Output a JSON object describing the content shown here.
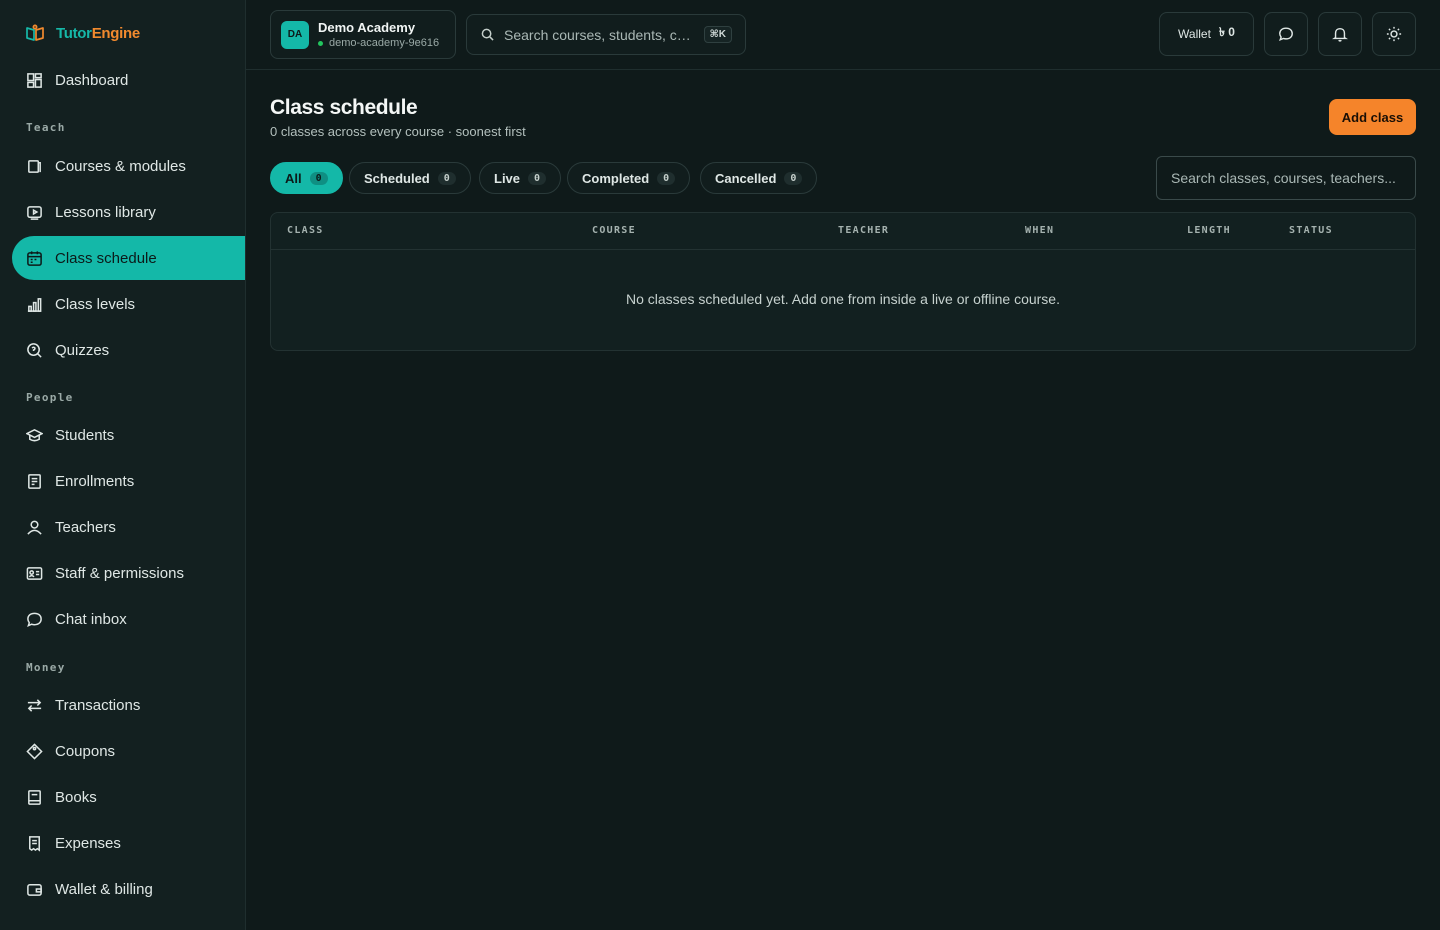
{
  "brand": {
    "name_part1": "Tutor",
    "name_part2": "Engine",
    "logo_icon": "book-open-icon"
  },
  "sidebar": {
    "dashboard": {
      "label": "Dashboard",
      "icon": "grid-icon"
    },
    "sections": {
      "teach": "Teach",
      "people": "People",
      "money": "Money"
    },
    "items": [
      {
        "label": "Courses & modules",
        "icon": "book-icon"
      },
      {
        "label": "Lessons library",
        "icon": "play-icon"
      },
      {
        "label": "Class schedule",
        "icon": "calendar-icon",
        "active": true
      },
      {
        "label": "Class levels",
        "icon": "bar-chart-icon"
      },
      {
        "label": "Quizzes",
        "icon": "quiz-search-icon"
      },
      {
        "label": "Students",
        "icon": "graduation-cap-icon"
      },
      {
        "label": "Enrollments",
        "icon": "clipboard-icon"
      },
      {
        "label": "Teachers",
        "icon": "user-icon"
      },
      {
        "label": "Staff & permissions",
        "icon": "id-card-icon"
      },
      {
        "label": "Chat inbox",
        "icon": "chat-icon"
      },
      {
        "label": "Transactions",
        "icon": "transfer-icon"
      },
      {
        "label": "Coupons",
        "icon": "tag-icon"
      },
      {
        "label": "Books",
        "icon": "book-icon"
      },
      {
        "label": "Expenses",
        "icon": "receipt-icon"
      },
      {
        "label": "Wallet & billing",
        "icon": "wallet-icon"
      }
    ]
  },
  "topbar": {
    "org": {
      "initials": "DA",
      "name": "Demo Academy",
      "slug": "demo-academy-9e616"
    },
    "search": {
      "placeholder": "Search courses, students, cla...",
      "shortcut": "⌘K"
    },
    "wallet": {
      "label": "Wallet",
      "currency": "৳",
      "amount": "0"
    }
  },
  "main": {
    "title": "Class schedule",
    "subtitle": "0 classes across every course · soonest first",
    "add_button": "Add class",
    "tabs": [
      {
        "label": "All",
        "count": "0"
      },
      {
        "label": "Scheduled",
        "count": "0"
      },
      {
        "label": "Live",
        "count": "0"
      },
      {
        "label": "Completed",
        "count": "0"
      },
      {
        "label": "Cancelled",
        "count": "0"
      }
    ],
    "search_placeholder": "Search classes, courses, teachers...",
    "table": {
      "columns": [
        "CLASS",
        "COURSE",
        "TEACHER",
        "WHEN",
        "LENGTH",
        "STATUS"
      ],
      "empty_message": "No classes scheduled yet. Add one from inside a live or offline course."
    }
  },
  "colors": {
    "accent": "#14b8a8",
    "brand_orange": "#f5842a",
    "background": "#0f1a1a"
  }
}
